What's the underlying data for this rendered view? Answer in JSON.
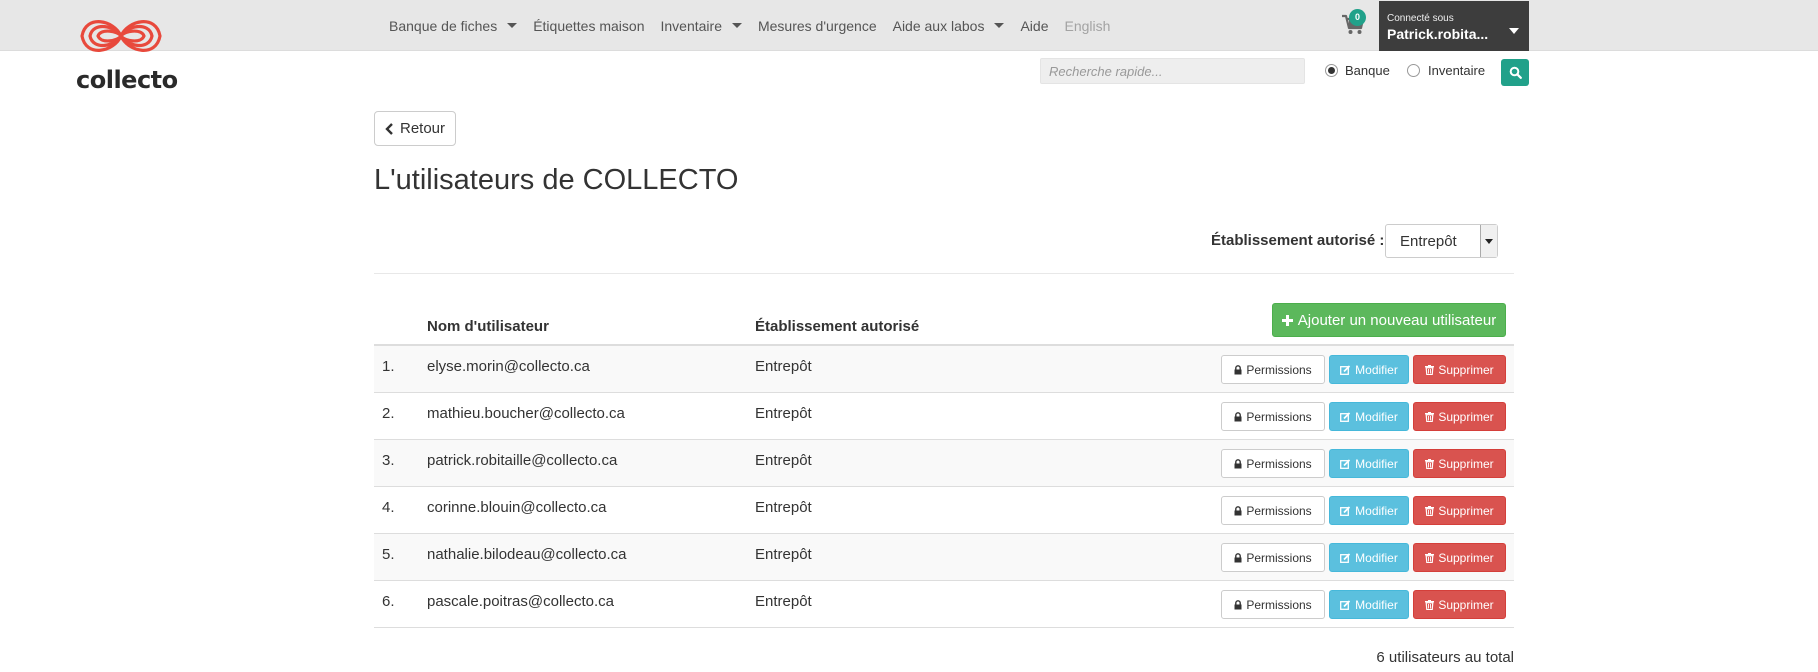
{
  "brand": {
    "name": "collecto",
    "logo_color": "#e8493c"
  },
  "nav": {
    "items": [
      {
        "label": "Banque de fiches",
        "dropdown": true
      },
      {
        "label": "Étiquettes maison",
        "dropdown": false
      },
      {
        "label": "Inventaire",
        "dropdown": true
      },
      {
        "label": "Mesures d'urgence",
        "dropdown": false
      },
      {
        "label": "Aide aux labos",
        "dropdown": true
      },
      {
        "label": "Aide",
        "dropdown": false
      },
      {
        "label": "English",
        "dropdown": false,
        "muted": true
      }
    ],
    "cart_count": "0",
    "user_small": "Connecté sous",
    "user_name": "Patrick.robita..."
  },
  "search": {
    "placeholder": "Recherche rapide...",
    "options": [
      {
        "label": "Banque",
        "checked": true
      },
      {
        "label": "Inventaire",
        "checked": false
      }
    ]
  },
  "page": {
    "back_label": "Retour",
    "title": "L'utilisateurs de COLLECTO",
    "filter_label": "Établissement autorisé :",
    "filter_value": "Entrepôt",
    "add_button_label": "Ajouter un nouveau utilisateur",
    "total_label": "6 utilisateurs au total"
  },
  "table": {
    "columns": [
      "Nom d'utilisateur",
      "Établissement autorisé"
    ],
    "actions": {
      "permissions": "Permissions",
      "modify": "Modifier",
      "delete": "Supprimer"
    },
    "rows": [
      {
        "num": "1.",
        "user": "elyse.morin@collecto.ca",
        "etab": "Entrepôt"
      },
      {
        "num": "2.",
        "user": "mathieu.boucher@collecto.ca",
        "etab": "Entrepôt"
      },
      {
        "num": "3.",
        "user": "patrick.robitaille@collecto.ca",
        "etab": "Entrepôt"
      },
      {
        "num": "4.",
        "user": "corinne.blouin@collecto.ca",
        "etab": "Entrepôt"
      },
      {
        "num": "5.",
        "user": "nathalie.bilodeau@collecto.ca",
        "etab": "Entrepôt"
      },
      {
        "num": "6.",
        "user": "pascale.poitras@collecto.ca",
        "etab": "Entrepôt"
      }
    ]
  },
  "colors": {
    "primary_green": "#21a18a",
    "success": "#5cb85c",
    "info": "#5bc0de",
    "danger": "#d9534f",
    "user_box": "#3d3d3d"
  },
  "icons": [
    "logo-infinity-icon",
    "cart-icon",
    "search-icon",
    "chevron-left-icon",
    "plus-icon",
    "lock-icon",
    "edit-icon",
    "trash-icon"
  ]
}
